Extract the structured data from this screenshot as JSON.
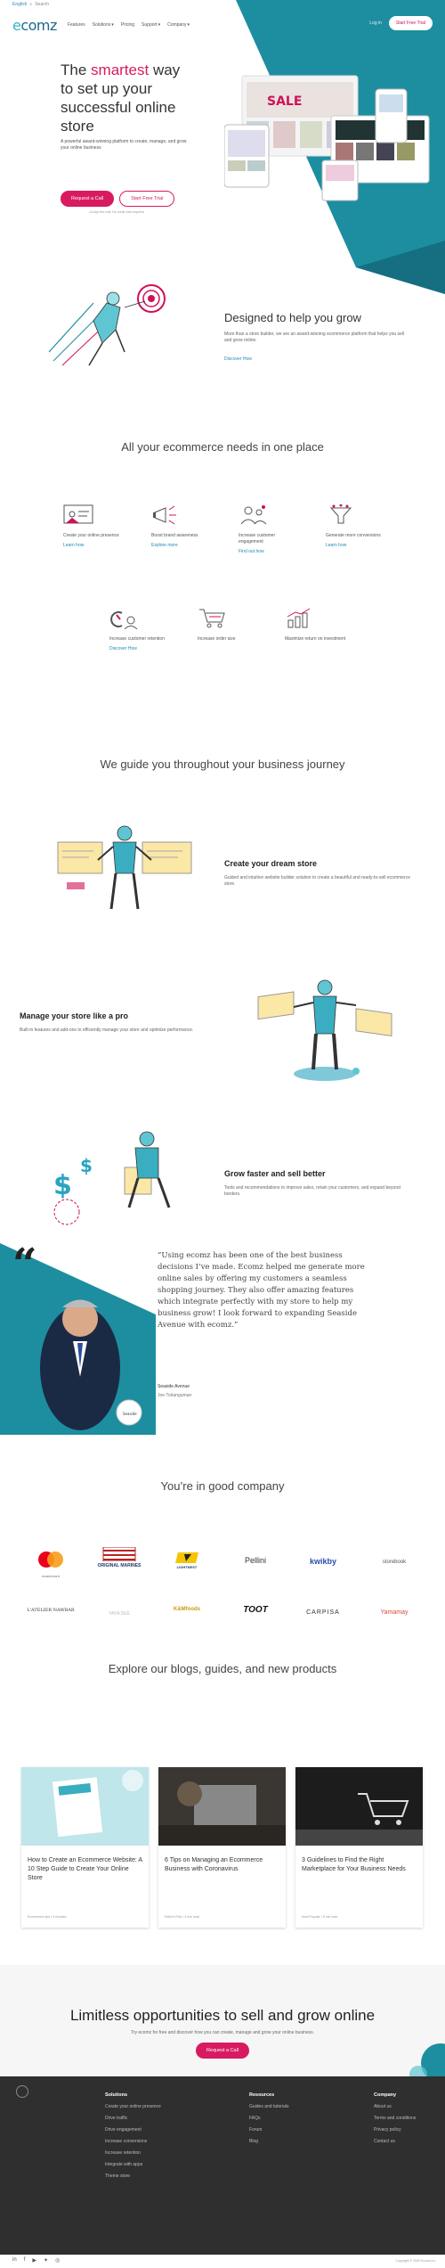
{
  "topbar": {
    "lang": "English",
    "search": "Search"
  },
  "header": {
    "logo": "ecomz",
    "nav": [
      "Features",
      "Solutions",
      "Pricing",
      "Support",
      "Company"
    ],
    "login": "Log in",
    "trial": "Start Free Trial"
  },
  "hero": {
    "title_a": "The ",
    "title_pink": "smartest",
    "title_b": " way to set up your successful online store",
    "desc": "A powerful award-winning platform to create, manage, and grow your online business",
    "btn_call": "Request a Call",
    "btn_trial": "Start Free Trial",
    "note": "14-day free trial. No credit card required"
  },
  "designed": {
    "title": "Designed to help you grow",
    "body": "More than a store builder, we are an award-winning ecommerce platform that helps you sell and grow online.",
    "link": "Discover How"
  },
  "needs": {
    "title": "All your ecommerce needs in one place",
    "items": [
      {
        "name": "Create your online presence",
        "link": "Learn how"
      },
      {
        "name": "Boost brand awareness",
        "link": "Explore more"
      },
      {
        "name": "Increase customer engagement",
        "link": "Find out how"
      },
      {
        "name": "Generate more conversions",
        "link": "Learn how"
      },
      {
        "name": "Increase customer retention",
        "link": "Discover How"
      },
      {
        "name": "Increase order size",
        "link": ""
      },
      {
        "name": "Maximize return on investment",
        "link": ""
      }
    ]
  },
  "journey": {
    "title": "We guide you throughout your business journey",
    "s1": {
      "title": "Create your dream store",
      "body": "Guided and intuitive website builder solution to create a beautiful and ready-to-sell ecommerce store."
    },
    "s2": {
      "title": "Manage your store like a pro",
      "body": "Built-in features and add-ons to efficiently manage your store and optimize performance."
    },
    "s3": {
      "title": "Grow faster and sell better",
      "body": "Tools and recommendations to improve sales, retain your customers, and expand beyond borders."
    }
  },
  "testimonial": {
    "quote": "“Using ecomz has been one of the best business decisions I’ve made. Ecomz helped me generate more online sales by offering my customers a seamless shopping journey. They also offer amazing features which integrate perfectly with my store to help my business grow! I look forward to expanding Seaside Avenue with ecomz.”",
    "company": "Seaside Avenue",
    "person": "Joe Torlanguman"
  },
  "company": {
    "title": "You’re in good company",
    "row1": [
      "mastercard",
      "ORIGINAL MARINES",
      "LIGHTNEST",
      "Pellini",
      "kwikby",
      "storebook"
    ],
    "row2": [
      "L'ATELIER NAWBAR",
      "YAYA DEE",
      "K&Mfoods",
      "TOOT",
      "CARPISA",
      "Yamamay"
    ]
  },
  "blogs": {
    "title": "Explore our blogs, guides, and new products",
    "cards": [
      {
        "title": "How to Create an Ecommerce Website: A 10 Step Guide to Create Your Online Store",
        "meta": "Ecommerce tips • 5 minutes"
      },
      {
        "title": "6 Tips on Managing an Ecommerce Business with Coronavirus",
        "meta": "Editor's Pick • 4 min read"
      },
      {
        "title": "3 Guidelines to Find the Right Marketplace for Your Business Needs",
        "meta": "Most Popular • 5 min read"
      }
    ]
  },
  "cta": {
    "title": "Limitless opportunities to sell and grow online",
    "body": "Try ecomz for free and discover how you can create, manage and grow your online business.",
    "btn": "Request a Call"
  },
  "footer": {
    "solutions": {
      "h": "Solutions",
      "items": [
        "Create your online presence",
        "Drive traffic",
        "Drive engagement",
        "Increase conversions",
        "Increase retention",
        "Integrate with apps",
        "Theme store"
      ]
    },
    "resources": {
      "h": "Resources",
      "items": [
        "Guides and tutorials",
        "FAQs",
        "Forum",
        "Blog"
      ]
    },
    "company": {
      "h": "Company",
      "items": [
        "About us",
        "Terms and conditions",
        "Privacy policy",
        "Contact us"
      ]
    },
    "copyright": "Copyright © 2020 Ecomz Inc."
  },
  "colors": {
    "teal": "#1d8ea0",
    "pink": "#d81b60",
    "dark": "#2f2f2f"
  }
}
